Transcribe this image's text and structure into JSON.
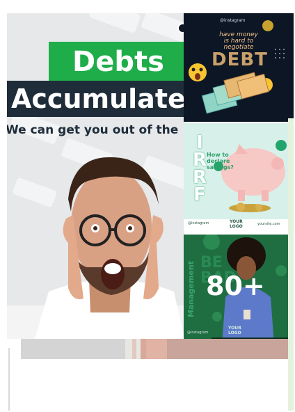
{
  "main": {
    "title_top": "Debts",
    "title_bottom": "Accumulate",
    "subtitle": "We can get you out of the"
  },
  "card1": {
    "instagram": "@instagram",
    "headline": "have money\nis hard to\nnegotiate",
    "big": "DEBT"
  },
  "card2": {
    "irrf": "IRRF",
    "question": "How to\ndeclare\nsavings?",
    "instagram": "@instagram",
    "logo": "YOUR\nLOGO",
    "site": "yoursite.com"
  },
  "card3": {
    "word": "BE\nBAD",
    "vertical": "Management",
    "overlay": "80+",
    "logo": "YOUR\nLOGO",
    "instagram": "@instagram"
  },
  "colors": {
    "green": "#1fad4a",
    "navy": "#1f2d3a",
    "card3_green": "#1e6e42"
  }
}
